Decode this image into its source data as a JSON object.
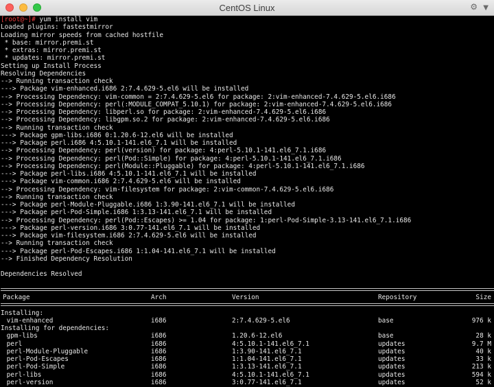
{
  "window": {
    "title": "CentOS Linux"
  },
  "prompt": {
    "user": "[root@~]#",
    "command": " yum install vim"
  },
  "log_lines": [
    "Loaded plugins: fastestmirror",
    "Loading mirror speeds from cached hostfile",
    " * base: mirror.premi.st",
    " * extras: mirror.premi.st",
    " * updates: mirror.premi.st",
    "Setting up Install Process",
    "Resolving Dependencies",
    "--> Running transaction check",
    "---> Package vim-enhanced.i686 2:7.4.629-5.el6 will be installed",
    "--> Processing Dependency: vim-common = 2:7.4.629-5.el6 for package: 2:vim-enhanced-7.4.629-5.el6.i686",
    "--> Processing Dependency: perl(:MODULE_COMPAT_5.10.1) for package: 2:vim-enhanced-7.4.629-5.el6.i686",
    "--> Processing Dependency: libperl.so for package: 2:vim-enhanced-7.4.629-5.el6.i686",
    "--> Processing Dependency: libgpm.so.2 for package: 2:vim-enhanced-7.4.629-5.el6.i686",
    "--> Running transaction check",
    "---> Package gpm-libs.i686 0:1.20.6-12.el6 will be installed",
    "---> Package perl.i686 4:5.10.1-141.el6_7.1 will be installed",
    "--> Processing Dependency: perl(version) for package: 4:perl-5.10.1-141.el6_7.1.i686",
    "--> Processing Dependency: perl(Pod::Simple) for package: 4:perl-5.10.1-141.el6_7.1.i686",
    "--> Processing Dependency: perl(Module::Pluggable) for package: 4:perl-5.10.1-141.el6_7.1.i686",
    "---> Package perl-libs.i686 4:5.10.1-141.el6_7.1 will be installed",
    "---> Package vim-common.i686 2:7.4.629-5.el6 will be installed",
    "--> Processing Dependency: vim-filesystem for package: 2:vim-common-7.4.629-5.el6.i686",
    "--> Running transaction check",
    "---> Package perl-Module-Pluggable.i686 1:3.90-141.el6_7.1 will be installed",
    "---> Package perl-Pod-Simple.i686 1:3.13-141.el6_7.1 will be installed",
    "--> Processing Dependency: perl(Pod::Escapes) >= 1.04 for package: 1:perl-Pod-Simple-3.13-141.el6_7.1.i686",
    "---> Package perl-version.i686 3:0.77-141.el6_7.1 will be installed",
    "---> Package vim-filesystem.i686 2:7.4.629-5.el6 will be installed",
    "--> Running transaction check",
    "---> Package perl-Pod-Escapes.i686 1:1.04-141.el6_7.1 will be installed",
    "--> Finished Dependency Resolution"
  ],
  "resolved": "Dependencies Resolved",
  "table": {
    "headers": [
      "Package",
      "Arch",
      "Version",
      "Repository",
      "Size"
    ],
    "installing_label": "Installing:",
    "installing": [
      [
        "vim-enhanced",
        "i686",
        "2:7.4.629-5.el6",
        "base",
        "976 k"
      ]
    ],
    "deps_label": "Installing for dependencies:",
    "deps": [
      [
        "gpm-libs",
        "i686",
        "1.20.6-12.el6",
        "base",
        "28 k"
      ],
      [
        "perl",
        "i686",
        "4:5.10.1-141.el6_7.1",
        "updates",
        "9.7 M"
      ],
      [
        "perl-Module-Pluggable",
        "i686",
        "1:3.90-141.el6_7.1",
        "updates",
        "40 k"
      ],
      [
        "perl-Pod-Escapes",
        "i686",
        "1:1.04-141.el6_7.1",
        "updates",
        "33 k"
      ],
      [
        "perl-Pod-Simple",
        "i686",
        "1:3.13-141.el6_7.1",
        "updates",
        "213 k"
      ],
      [
        "perl-libs",
        "i686",
        "4:5.10.1-141.el6_7.1",
        "updates",
        "594 k"
      ],
      [
        "perl-version",
        "i686",
        "3:0.77-141.el6_7.1",
        "updates",
        "52 k"
      ]
    ]
  },
  "colors": {
    "background": "#000000",
    "text": "#e8e8e8",
    "prompt": "#ef3d3d"
  },
  "icons": {
    "settings": "gear-icon",
    "menu": "chevron-down-icon"
  }
}
